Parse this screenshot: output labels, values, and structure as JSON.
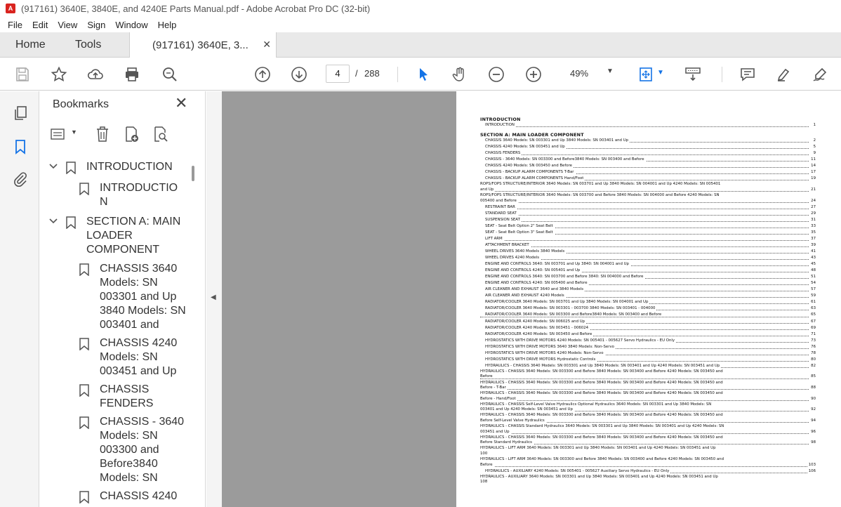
{
  "window": {
    "title": "(917161) 3640E, 3840E, and 4240E Parts Manual.pdf - Adobe Acrobat Pro DC (32-bit)"
  },
  "menu": [
    "File",
    "Edit",
    "View",
    "Sign",
    "Window",
    "Help"
  ],
  "tabs": {
    "home": "Home",
    "tools": "Tools",
    "doc": "(917161) 3640E, 3...",
    "close": "✕"
  },
  "toolbar": {
    "page_current": "4",
    "page_sep": "/",
    "page_total": "288",
    "zoom": "49%",
    "icons": [
      "save-icon",
      "bookmark-star-icon",
      "upload-icon",
      "print-icon",
      "search-icon",
      "page-up-icon",
      "page-down-icon",
      "select-arrow-icon",
      "hand-icon",
      "zoom-out-icon",
      "zoom-in-icon",
      "fit-page-icon",
      "scroll-mode-icon",
      "comment-icon",
      "highlight-icon",
      "sign-icon"
    ]
  },
  "bookmarks": {
    "title": "Bookmarks",
    "close": "✕",
    "items": [
      {
        "label": "INTRODUCTION",
        "level": 0,
        "expanded": true
      },
      {
        "label": "INTRODUCTIO N",
        "level": 1
      },
      {
        "label": "SECTION A: MAIN LOADER COMPONENT",
        "level": 0,
        "expanded": true
      },
      {
        "label": "CHASSIS 3640 Models: SN 003301 and Up 3840 Models: SN 003401 and",
        "level": 1
      },
      {
        "label": "CHASSIS 4240 Models: SN 003451 and Up",
        "level": 1
      },
      {
        "label": "CHASSIS FENDERS",
        "level": 1
      },
      {
        "label": "CHASSIS - 3640 Models: SN 003300 and Before3840 Models: SN",
        "level": 1
      },
      {
        "label": "CHASSIS 4240",
        "level": 1
      }
    ]
  },
  "document": {
    "intro_heading": "INTRODUCTION",
    "intro_line": {
      "text": "INTRODUCTION",
      "page": "1"
    },
    "section_heading": "SECTION A: MAIN LOADER COMPONENT",
    "entries": [
      {
        "text": "CHASSIS 3640 Models: SN 003301 and Up 3840 Models: SN 003401 and Up",
        "page": "2"
      },
      {
        "text": "CHASSIS 4240 Models: SN 003451 and Up",
        "page": "5"
      },
      {
        "text": "CHASSIS FENDERS",
        "page": "9"
      },
      {
        "text": "CHASSIS - 3640 Models: SN 003300 and Before3840 Models: SN 003400 and Before",
        "page": "11"
      },
      {
        "text": "CHASSIS 4240 Models: SN 003450 and Before",
        "page": "14"
      },
      {
        "text": "CHASSIS - BACKUP ALARM COMPONENTS T-Bar",
        "page": "17"
      },
      {
        "text": "CHASSIS - BACKUP ALARM COMPONENTS Hand/Foot",
        "page": "19"
      },
      {
        "text": "ROPS/FOPS STRUCTURE/INTERIOR 3640 Models: SN 003701 and Up 3840 Models: SN 004001 and Up 4240 Models: SN 005401",
        "cont": "and Up",
        "page": "21"
      },
      {
        "text": "ROPS/FOPS STRUCTURE/INTERIOR 3640 Models: SN 003700 and Before 3840 Models: SN 004000 and Before 4240 Models: SN",
        "cont": "005400 and Before",
        "page": "24"
      },
      {
        "text": "RESTRAINT BAR",
        "page": "27"
      },
      {
        "text": "STANDARD SEAT",
        "page": "29"
      },
      {
        "text": "SUSPENSION SEAT",
        "page": "31"
      },
      {
        "text": "SEAT - Seat Belt Option 2\" Seat Belt",
        "page": "33"
      },
      {
        "text": "SEAT - Seat Belt Option 3\" Seat Belt",
        "page": "35"
      },
      {
        "text": "LIFT ARM",
        "page": "37"
      },
      {
        "text": "ATTACHMENT BRACKET",
        "page": "39"
      },
      {
        "text": "WHEEL DRIVES 3640 Models 3840 Models",
        "page": "41"
      },
      {
        "text": "WHEEL DRIVES 4240 Models",
        "page": "43"
      },
      {
        "text": "ENGINE AND CONTROLS 3640: SN 003701 and Up 3840: SN 004001 and Up",
        "page": "45"
      },
      {
        "text": "ENGINE AND CONTROLS 4240: SN 005401 and Up",
        "page": "48"
      },
      {
        "text": "ENGINE AND CONTROLS 3640: SN 003700 and Before 3840: SN 004000 and Before",
        "page": "51"
      },
      {
        "text": "ENGINE AND CONTROLS 4240: SN 005400 and Before",
        "page": "54"
      },
      {
        "text": "AIR CLEANER AND EXHAUST 3640 and 3840 Models",
        "page": "57"
      },
      {
        "text": "AIR CLEANER AND EXHAUST 4240 Models",
        "page": "59"
      },
      {
        "text": "RADIATOR/COOLER 3640 Models: SN 003701 and Up 3840 Models: SN 004001 and Up",
        "page": "61"
      },
      {
        "text": "RADIATOR/COOLER 3640 Models: SN 003301 - 003700 3840 Models: SN 003401 - 004000",
        "page": "63"
      },
      {
        "text": "RADIATOR/COOLER 3640 Models: SN 003300 and Before3840 Models: SN 003400 and Before",
        "page": "65"
      },
      {
        "text": "RADIATOR/COOLER 4240 Models: SN 006025 and Up",
        "page": "67"
      },
      {
        "text": "RADIATOR/COOLER 4240 Models: SN 003451 - 006024",
        "page": "69"
      },
      {
        "text": "RADIATOR/COOLER 4240 Models: SN 003450 and Before",
        "page": "71"
      },
      {
        "text": "HYDROSTATICS WITH DRIVE MOTORS 4240 Models: SN 005401 - 005627 Servo Hydraulics - EU Only",
        "page": "73"
      },
      {
        "text": "HYDROSTATICS WITH DRIVE MOTORS 3640 3840 Models: Non-Servo",
        "page": "76"
      },
      {
        "text": "HYDROSTATICS WITH DRIVE MOTORS 4240 Models: Non-Servo",
        "page": "78"
      },
      {
        "text": "HYDROSTATICS WITH DRIVE MOTORS Hydrostatic Controls",
        "page": "80"
      },
      {
        "text": "HYDRAULICS - CHASSIS 3640 Models: SN 003301 and Up 3840 Models: SN 003401 and Up 4240 Models: SN 003451 and Up",
        "page": "82"
      },
      {
        "text": "HYDRAULICS - CHASSIS 3640 Models: SN 003300 and Before 3840 Models: SN 003400 and Before 4240 Models: SN 003450 and",
        "cont": "Before",
        "page": "85"
      },
      {
        "text": "HYDRAULICS - CHASSIS 3640 Models: SN 003300 and Before 3840 Models: SN 003400 and Before 4240 Models: SN 003450 and",
        "cont": "Before - T-Bar",
        "page": "88"
      },
      {
        "text": "HYDRAULICS - CHASSIS 3640 Models: SN 003300 and Before 3840 Models: SN 003400 and Before 4240 Models: SN 003450 and",
        "cont": "Before - Hand/Foot",
        "page": "90"
      },
      {
        "text": "HYDRAULICS - CHASSIS Self-Level Valve Hydraulics Optional Hydraulics 3640 Models: SN 003301 and Up 3840 Models: SN",
        "cont": "003401 and Up 4240 Models: SN 003451 and Up",
        "page": "92"
      },
      {
        "text": "HYDRAULICS - CHASSIS 3640 Models: SN 003300 and Before 3840 Models: SN 003400 and Before 4240 Models: SN 003450 and",
        "cont": "Before Self-Level Valve Hydraulics",
        "page": "94"
      },
      {
        "text": "HYDRAULICS - CHASSIS Standard Hydraulics 3640 Models: SN 003301 and Up 3840 Models: SN 003401 and Up 4240 Models: SN",
        "cont": "003451 and Up",
        "page": "96"
      },
      {
        "text": "HYDRAULICS - CHASSIS 3640 Models: SN 003300 and Before 3840 Models: SN 003400 and Before 4240 Models: SN 003450 and",
        "cont": "Before Standard Hydraulics",
        "page": "98"
      },
      {
        "text": "HYDRAULICS - LIFT ARM 3640 Models: SN 003301 and Up 3840 Models: SN 003401 and Up 4240 Models: SN 003451 and Up",
        "cont": "100",
        "page": ""
      },
      {
        "text": "HYDRAULICS - LIFT ARM 3640 Models: SN 003300 and Before 3840 Models: SN 003400 and Before 4240 Models: SN 003450 and",
        "cont": "Before",
        "page": "103"
      },
      {
        "text": "HYDRAULICS - AUXILIARY 4240 Models: SN 005401 - 005627 Auxiliary Servo Hydraulics - EU Only",
        "page": "106"
      },
      {
        "text": "HYDRAULICS - AUXILIARY 3640 Models: SN 003301 and Up 3840 Models: SN 003401 and Up 4240 Models: SN 003451 and Up",
        "cont": "108",
        "page": ""
      }
    ]
  },
  "colors": {
    "accent": "#1473e6",
    "acrobat_red": "#d9231f",
    "doc_background": "#9b9b9b"
  }
}
